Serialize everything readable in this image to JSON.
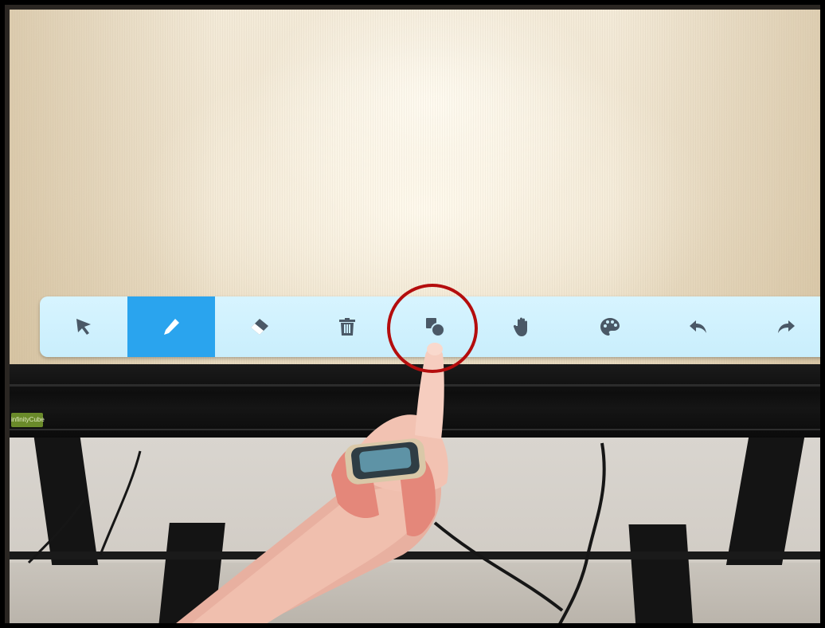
{
  "toolbar": {
    "tools": [
      {
        "id": "select",
        "icon": "pointer-arrow-icon",
        "active": false
      },
      {
        "id": "pen",
        "icon": "pen-icon",
        "active": true
      },
      {
        "id": "eraser",
        "icon": "eraser-icon",
        "active": false
      },
      {
        "id": "delete",
        "icon": "trash-icon",
        "active": false
      },
      {
        "id": "shapes",
        "icon": "shapes-icon",
        "active": false
      },
      {
        "id": "pan",
        "icon": "hand-icon",
        "active": false
      },
      {
        "id": "color",
        "icon": "palette-icon",
        "active": false
      },
      {
        "id": "undo",
        "icon": "undo-icon",
        "active": false
      },
      {
        "id": "redo",
        "icon": "redo-icon",
        "active": false
      }
    ]
  },
  "colors": {
    "toolbar_bg": "#cbeefc",
    "active_tool_bg": "#2aa4ee",
    "icon_color": "#4a5866",
    "highlight_ring": "#b40d0d"
  },
  "bezel_badge": {
    "text": "infinityCube"
  }
}
